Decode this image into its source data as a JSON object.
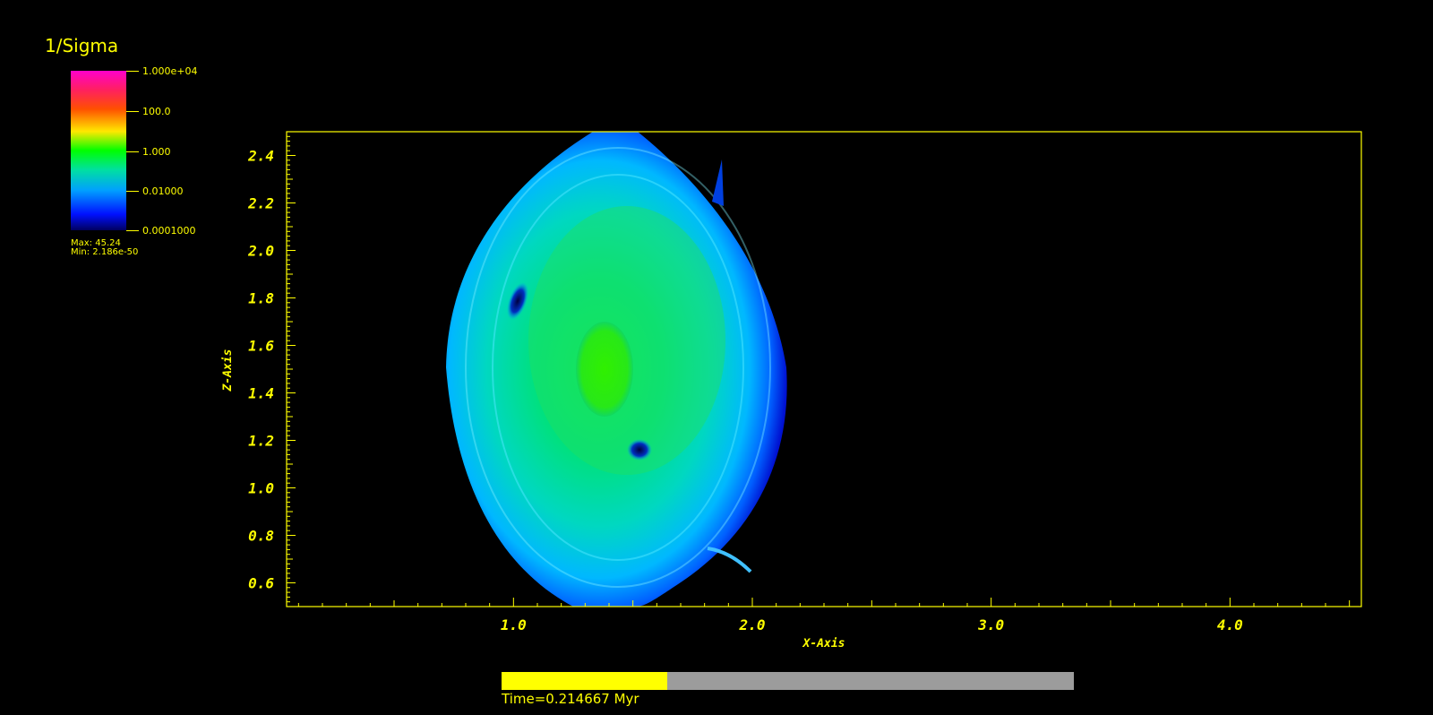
{
  "legend": {
    "title": "1/Sigma",
    "ticks": [
      "1.000e+04",
      "100.0",
      "1.000",
      "0.01000",
      "0.0001000"
    ],
    "max_label": "Max:  45.24",
    "min_label": "Min:  2.186e-50"
  },
  "chart_data": {
    "type": "heatmap",
    "variable": "1/Sigma",
    "xlabel": "X-Axis",
    "ylabel": "Z-Axis",
    "xlim": [
      0.05,
      4.55
    ],
    "ylim": [
      0.5,
      2.5
    ],
    "x_ticks": [
      "1.0",
      "2.0",
      "3.0",
      "4.0"
    ],
    "x_tick_values": [
      1.0,
      2.0,
      3.0,
      4.0
    ],
    "y_ticks": [
      "0.6",
      "0.8",
      "1.0",
      "1.2",
      "1.4",
      "1.6",
      "1.8",
      "2.0",
      "2.2",
      "2.4"
    ],
    "y_tick_values": [
      0.6,
      0.8,
      1.0,
      1.2,
      1.4,
      1.6,
      1.8,
      2.0,
      2.2,
      2.4
    ],
    "color_scale": "log",
    "color_range": [
      0.0001,
      10000
    ],
    "max": 45.24,
    "min": 2.186e-50,
    "colors": {
      "axis": "#ffff00",
      "background": "#000000",
      "low": "#0000ff",
      "mid_low": "#00c8ff",
      "mid": "#00ff80",
      "high": "#ffff00",
      "top": "#ff00c8"
    }
  },
  "time": {
    "label": "Time=0.214667 Myr",
    "progress": 0.29
  }
}
